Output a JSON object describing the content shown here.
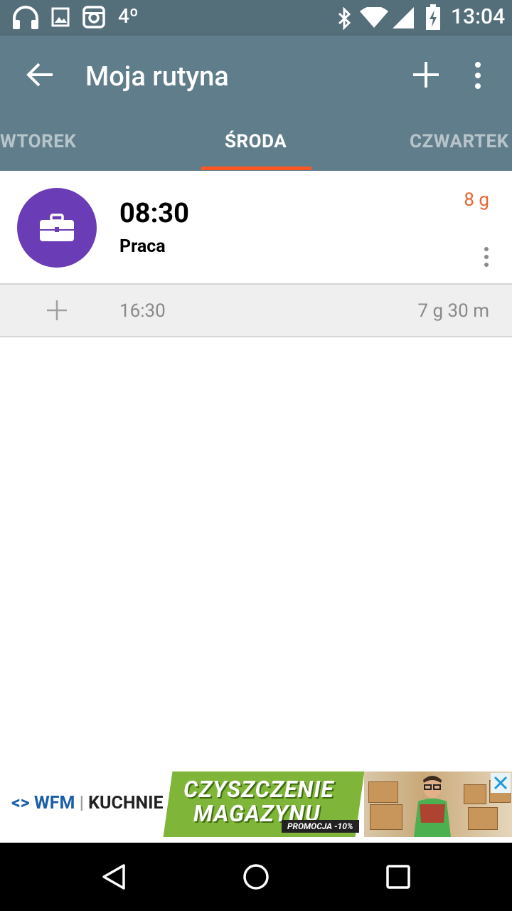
{
  "status_bar": {
    "temperature": "4º",
    "clock": "13:04",
    "icons": [
      "headphones-icon",
      "image-icon",
      "instagram-icon",
      "bluetooth-icon",
      "wifi-icon",
      "signal-icon",
      "battery-charging-icon"
    ]
  },
  "app_bar": {
    "title": "Moja rutyna",
    "back_icon": "arrow-left-icon",
    "add_icon": "plus-icon",
    "overflow_icon": "more-vert-icon"
  },
  "tabs": [
    {
      "label": "WTOREK",
      "active": false
    },
    {
      "label": "ŚRODA",
      "active": true
    },
    {
      "label": "CZWARTEK",
      "active": false
    }
  ],
  "routine_items": [
    {
      "time": "08:30",
      "label": "Praca",
      "duration": "8 g",
      "icon": "briefcase-icon",
      "icon_color": "#6A3CB5"
    }
  ],
  "free_slot": {
    "time": "16:30",
    "duration": "7 g 30 m"
  },
  "ad": {
    "brand_wfm": "WFM",
    "brand_kuchnie": "KUCHNIE",
    "headline_1": "CZYSZCZENIE",
    "headline_2": "MAGAZYNU",
    "promo": "PROMOCJA -10%"
  },
  "colors": {
    "status_bar": "#546E7A",
    "app_bar": "#607D8B",
    "tab_indicator": "#FF5722",
    "duration_accent": "#E8652F"
  }
}
